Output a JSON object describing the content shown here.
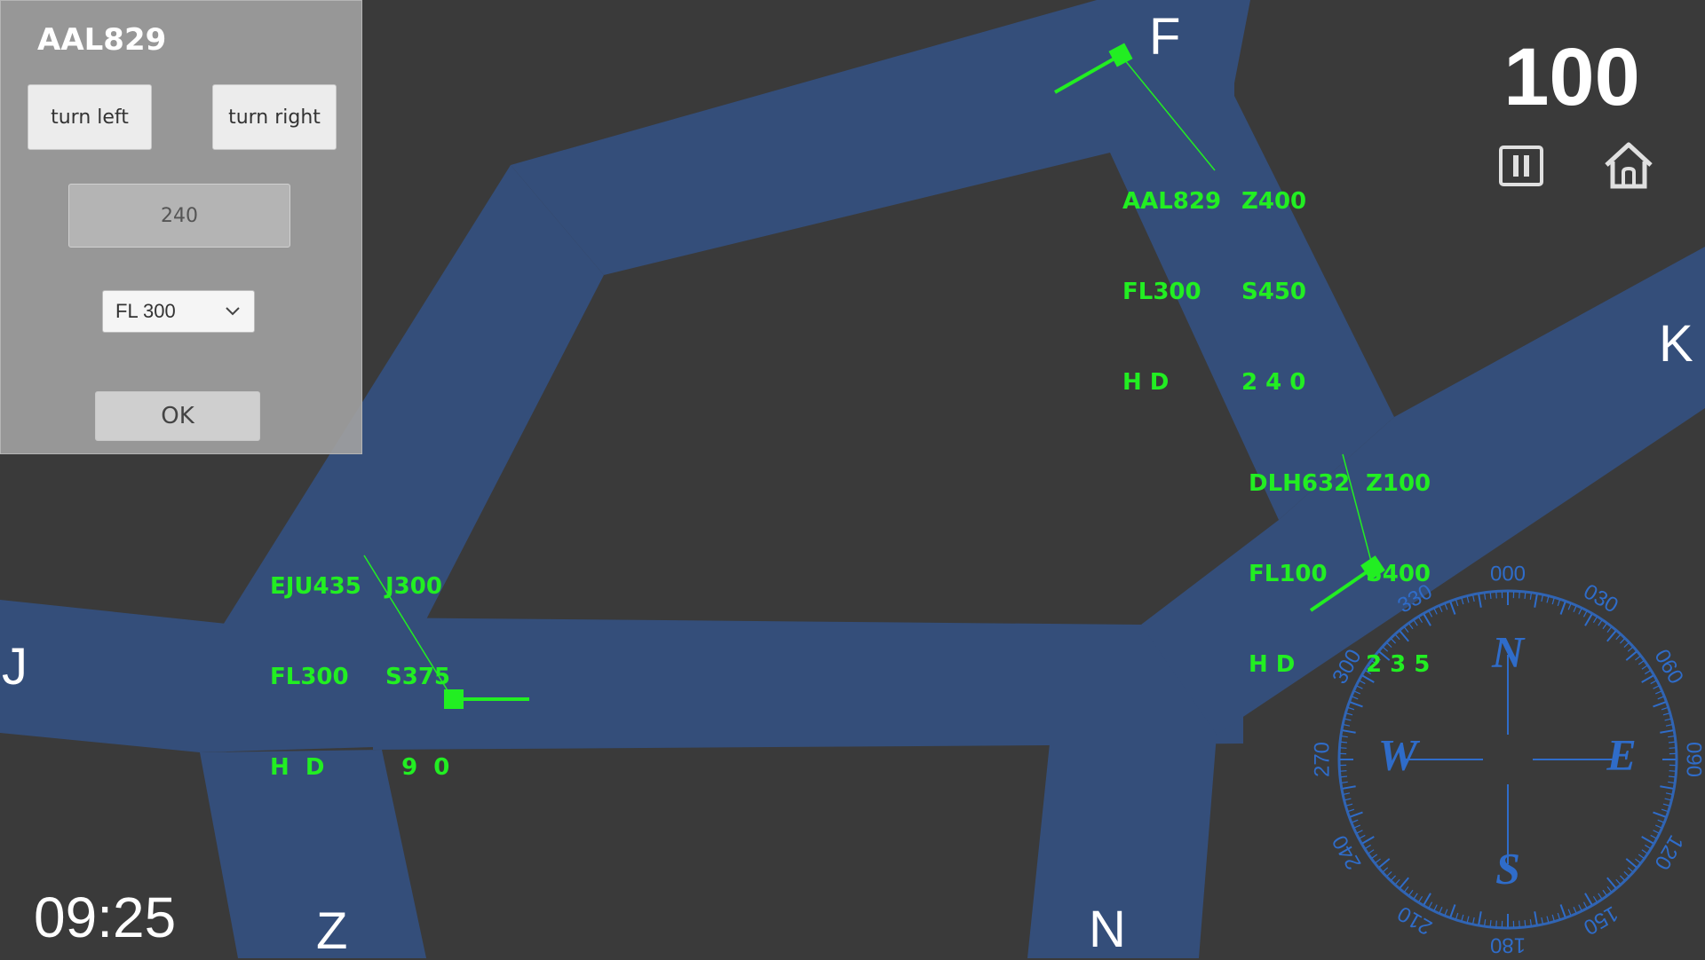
{
  "panel": {
    "selected_flight": "AAL829",
    "turn_left_label": "turn left",
    "turn_right_label": "turn right",
    "heading_value": "240",
    "altitude_selected": "FL 300",
    "ok_label": "OK"
  },
  "score": "100",
  "clock": "09:25",
  "waypoints": {
    "F": "F",
    "K": "K",
    "J": "J",
    "Z": "Z",
    "N": "N"
  },
  "flights": [
    {
      "callsign": "AAL829",
      "dest": "Z400",
      "level": "FL300",
      "speed": "S450",
      "hd_label": "H D",
      "heading": "2 4 0"
    },
    {
      "callsign": "DLH632",
      "dest": "Z100",
      "level": "FL100",
      "speed": "S400",
      "hd_label": "H D",
      "heading": "2 3 5"
    },
    {
      "callsign": "EJU435",
      "dest": "J300",
      "level": "FL300",
      "speed": "S375",
      "hd_label": "H  D",
      "heading": "  9  0"
    }
  ],
  "compass": {
    "cardinals": [
      "N",
      "E",
      "S",
      "W"
    ],
    "degree_labels": [
      "000",
      "030",
      "060",
      "090",
      "120",
      "150",
      "180",
      "210",
      "240",
      "270",
      "300",
      "330"
    ]
  },
  "colors": {
    "background": "#3a3a3a",
    "airway": "#344e7a",
    "aircraft": "#22ee22",
    "compass": "#2f6cc9"
  },
  "icons": {
    "pause": "pause-icon",
    "home": "home-icon",
    "dropdown": "chevron-down-icon"
  }
}
